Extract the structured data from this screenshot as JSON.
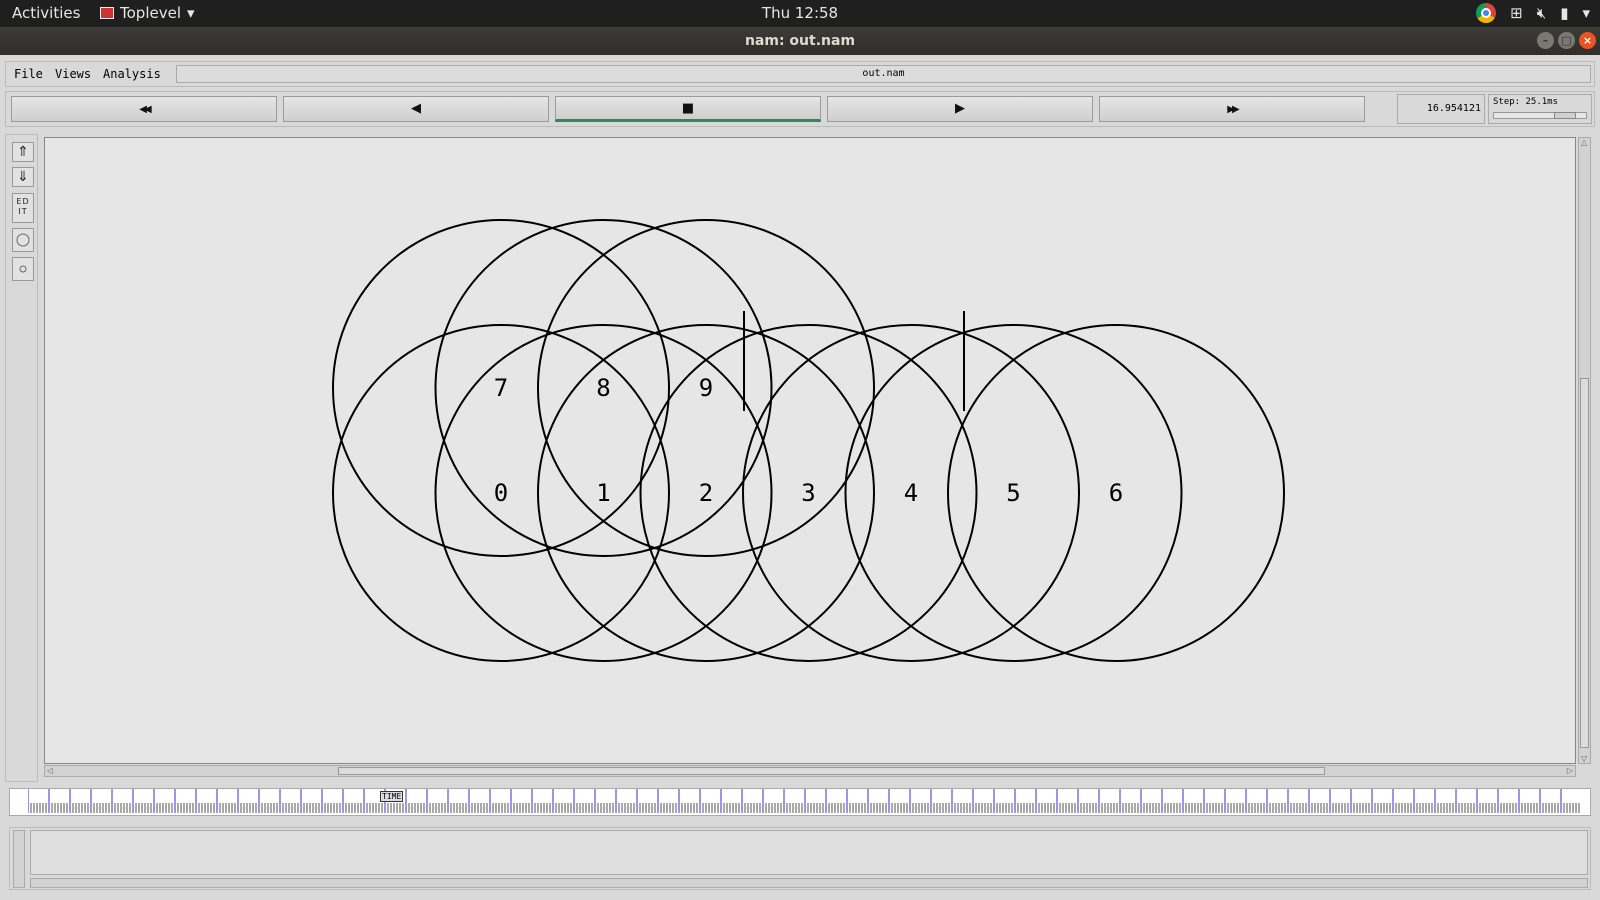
{
  "topbar": {
    "activities": "Activities",
    "app_name": "Toplevel",
    "clock": "Thu 12:58"
  },
  "window": {
    "title": "nam: out.nam",
    "minimize": "–",
    "maximize": "□",
    "close": "×"
  },
  "menu": {
    "file": "File",
    "views": "Views",
    "analysis": "Analysis",
    "filename": "out.nam"
  },
  "controls": {
    "rewind": "◀◀",
    "back": "◀",
    "stop": "■",
    "play": "▶",
    "fast_forward": "▶▶",
    "time": "16.954121",
    "step": "Step: 25.1ms"
  },
  "tools": {
    "zoom_in": "⇑",
    "zoom_out": "⇓",
    "edit": "ED IT"
  },
  "timeline": {
    "label": "TIME"
  },
  "nodes": [
    {
      "id": "0",
      "row": "bottom",
      "col": 0
    },
    {
      "id": "1",
      "row": "bottom",
      "col": 1
    },
    {
      "id": "2",
      "row": "bottom",
      "col": 2
    },
    {
      "id": "3",
      "row": "bottom",
      "col": 3
    },
    {
      "id": "4",
      "row": "bottom",
      "col": 4
    },
    {
      "id": "5",
      "row": "bottom",
      "col": 5
    },
    {
      "id": "6",
      "row": "bottom",
      "col": 6
    },
    {
      "id": "7",
      "row": "top",
      "col": 0
    },
    {
      "id": "8",
      "row": "top",
      "col": 1
    },
    {
      "id": "9",
      "row": "top",
      "col": 2
    }
  ]
}
